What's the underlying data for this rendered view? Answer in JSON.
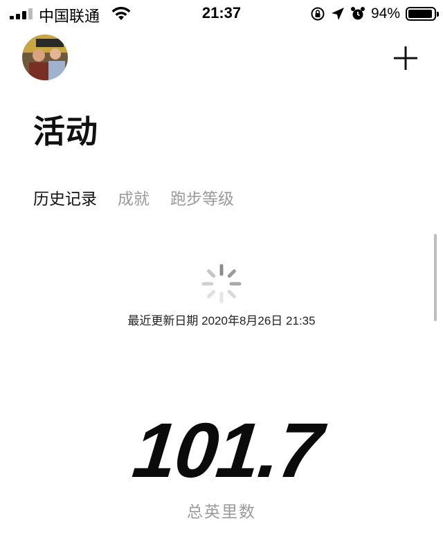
{
  "status_bar": {
    "carrier": "中国联通",
    "time": "21:37",
    "battery_percent": "94%",
    "battery_level": 0.94,
    "icons": [
      "cellular-signal-icon",
      "wifi-icon",
      "orientation-lock-icon",
      "location-arrow-icon",
      "alarm-icon",
      "battery-icon"
    ]
  },
  "header": {
    "title": "活动",
    "add_icon": "plus-icon"
  },
  "tabs": [
    {
      "label": "历史记录",
      "active": true
    },
    {
      "label": "成就",
      "active": false
    },
    {
      "label": "跑步等级",
      "active": false
    }
  ],
  "sync": {
    "updated_text": "最近更新日期 2020年8月26日 21:35"
  },
  "stats": {
    "total_value": "101.7",
    "total_label": "总英里数"
  },
  "colors": {
    "text_primary": "#111111",
    "text_secondary": "#9a9a9a",
    "background": "#ffffff"
  }
}
